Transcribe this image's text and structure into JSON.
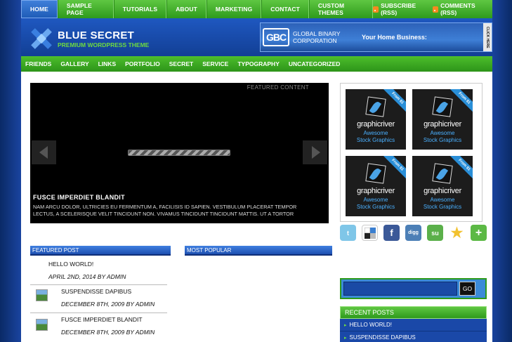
{
  "top_nav": {
    "items": [
      "Home",
      "Sample Page",
      "Tutorials",
      "About",
      "Marketing",
      "Contact",
      "Custom Themes"
    ],
    "active_index": 0,
    "subscribe_rss": "Subscribe (RSS)",
    "comments_rss": "Comments (RSS)"
  },
  "header": {
    "logo_title": "BLUE SECRET",
    "logo_subtitle": "PREMIUM WORDPRESS THEME",
    "banner": {
      "logo_text": "GBC",
      "company_line1": "GLOBAL BINARY",
      "company_line2": "CORPORATION",
      "tagline": "Your Home Business:",
      "click_here": "CLICK HERE"
    }
  },
  "category_nav": [
    "Friends",
    "Gallery",
    "Links",
    "Portfolio",
    "Secret",
    "Service",
    "Typography",
    "Uncategorized"
  ],
  "slider": {
    "label": "FEATURED CONTENT",
    "caption_title": "FUSCE IMPERDIET BLANDIT",
    "caption_text": "NAM ARCU DOLOR, ULTRICIES EU FERMENTUM A, FACILISIS ID SAPIEN. VESTIBULUM PLACERAT TEMPOR LECTUS, A SCELERISQUE VELIT TINCIDUNT NON. VIVAMUS TINCIDUNT TINCIDUNT MATTIS. UT A TORTOR"
  },
  "ads": [
    {
      "badge": "From $1",
      "brand": "graphicriver",
      "line1": "Awesome",
      "line2": "Stock Graphics"
    },
    {
      "badge": "From $1",
      "brand": "graphicriver",
      "line1": "Awesome",
      "line2": "Stock Graphics"
    },
    {
      "badge": "From $1",
      "brand": "graphicriver",
      "line1": "Awesome",
      "line2": "Stock Graphics"
    },
    {
      "badge": "From $1",
      "brand": "graphicriver",
      "line1": "Awesome",
      "line2": "Stock Graphics"
    }
  ],
  "social_icons": [
    {
      "name": "twitter-icon",
      "color": "#7fc6e8"
    },
    {
      "name": "delicious-icon",
      "color": "#3b7fd0"
    },
    {
      "name": "facebook-icon",
      "color": "#3b5998"
    },
    {
      "name": "digg-icon",
      "color": "#4c7fb6"
    },
    {
      "name": "stumbleupon-icon",
      "color": "#5bb04a"
    },
    {
      "name": "favorite-star-icon",
      "color": "#f2c230"
    },
    {
      "name": "add-plus-icon",
      "color": "#5cb945"
    }
  ],
  "featured_post": {
    "heading": "FEATURED POST",
    "posts": [
      {
        "title": "HELLO WORLD!",
        "date": "APRIL 2ND, 2014 BY ADMIN"
      },
      {
        "title": "SUSPENDISSE DAPIBUS",
        "date": "DECEMBER 8TH, 2009 BY ADMIN"
      },
      {
        "title": "FUSCE IMPERDIET BLANDIT",
        "date": "DECEMBER 8TH, 2009 BY ADMIN"
      }
    ]
  },
  "most_popular": {
    "heading": "MOST POPULAR"
  },
  "search": {
    "button": "GO"
  },
  "recent_posts": {
    "heading": "RECENT POSTS",
    "items": [
      "HELLO WORLD!",
      "SUSPENDISSE DAPIBUS"
    ]
  }
}
